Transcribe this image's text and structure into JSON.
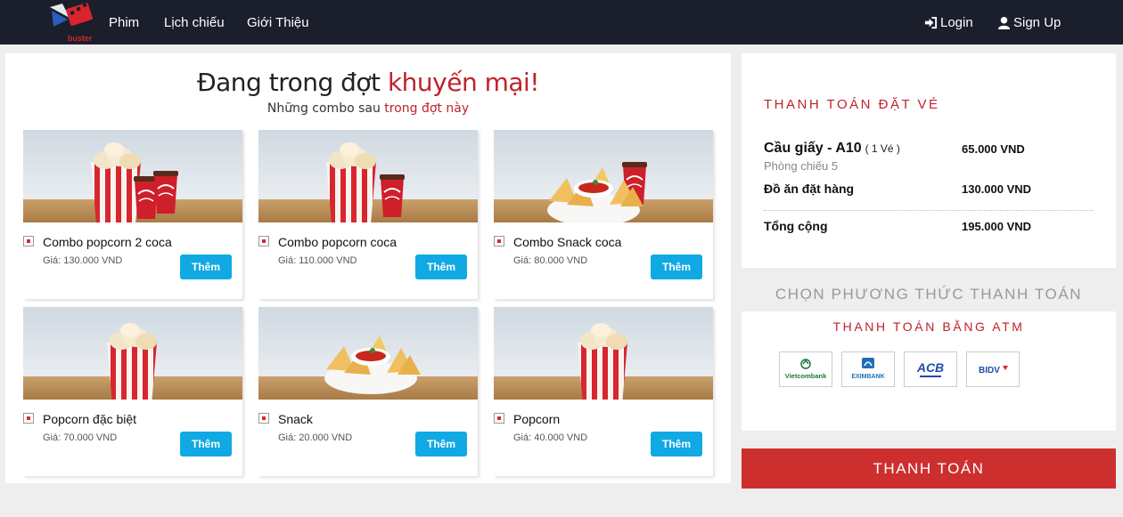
{
  "nav": {
    "logo_text": "buster",
    "links": [
      "Phim",
      "Lịch chiếu",
      "Giới Thiệu"
    ],
    "login_label": "Login",
    "signup_label": "Sign Up"
  },
  "promo": {
    "title_prefix": "Đang trong đợt ",
    "title_highlight": "khuyến mại!",
    "subtitle_prefix": "Những combo sau ",
    "subtitle_highlight": "trong đợt này"
  },
  "combos": [
    {
      "name": "Combo popcorn 2 coca",
      "price": "Giá: 130.000 VND",
      "button": "Thêm"
    },
    {
      "name": "Combo popcorn coca",
      "price": "Giá: 110.000 VND",
      "button": "Thêm"
    },
    {
      "name": "Combo Snack coca",
      "price": "Giá: 80.000 VND",
      "button": "Thêm"
    },
    {
      "name": "Popcorn đặc biệt",
      "price": "Giá: 70.000 VND",
      "button": "Thêm"
    },
    {
      "name": "Snack",
      "price": "Giá: 20.000 VND",
      "button": "Thêm"
    },
    {
      "name": "Popcorn",
      "price": "Giá: 40.000 VND",
      "button": "Thêm"
    }
  ],
  "summary": {
    "title": "THANH TOÁN ĐẶT VÉ",
    "seat": "Cầu giấy - A10",
    "seat_count": "( 1 Vé )",
    "seat_price": "65.000 VND",
    "room": "Phòng chiếu 5",
    "food_label": "Đồ ăn đặt hàng",
    "food_price": "130.000 VND",
    "total_label": "Tổng cộng",
    "total_price": "195.000 VND"
  },
  "payment": {
    "heading": "CHỌN PHƯƠNG THỨC THANH TOÁN",
    "atm_title": "THANH TOÁN BẰNG ATM",
    "banks": [
      {
        "name": "Vietcombank",
        "color": "#1a7a3c"
      },
      {
        "name": "EXIMBANK",
        "color": "#1f6fb5"
      },
      {
        "name": "ACB",
        "color": "#1e4fa3"
      },
      {
        "name": "BIDV",
        "color": "#1e4fa3"
      }
    ],
    "checkout_label": "THANH TOÁN"
  },
  "colors": {
    "accent_red": "#c0222c",
    "button_blue": "#11a9e3",
    "navbar_bg": "#1b1e2b",
    "checkout_bg": "#cd2f2f"
  }
}
